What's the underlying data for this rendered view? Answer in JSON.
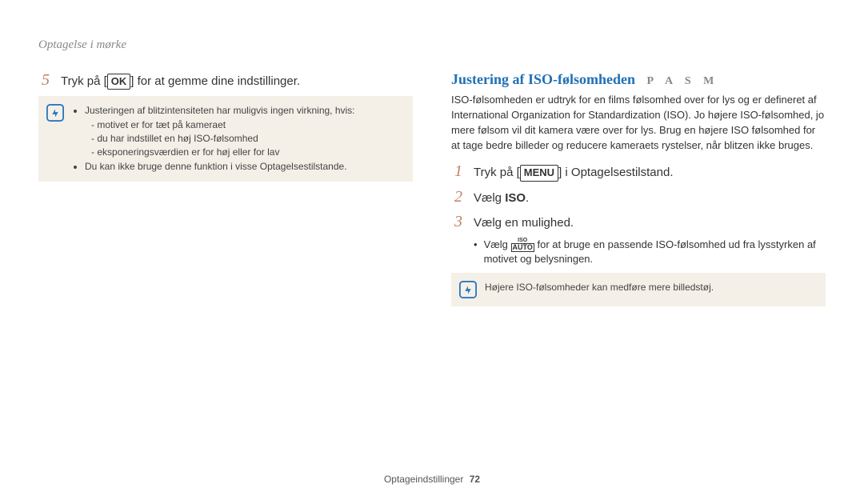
{
  "header": "Optagelse i mørke",
  "left": {
    "step5": {
      "num": "5",
      "pre": "Tryk på [",
      "key": "OK",
      "post": "] for at gemme dine indstillinger."
    },
    "note": {
      "intro": "Justeringen af blitzintensiteten har muligvis ingen virkning, hvis:",
      "sub": [
        "motivet er for tæt på kameraet",
        "du har indstillet en høj ISO-følsomhed",
        "eksponeringsværdien er for høj eller for lav"
      ],
      "line2": "Du kan ikke bruge denne funktion i visse Optagelsestilstande."
    }
  },
  "right": {
    "title": "Justering af ISO-følsomheden",
    "modes": "P A S M",
    "intro": "ISO-følsomheden er udtryk for en films følsomhed over for lys og er defineret af International Organization for Standardization (ISO). Jo højere ISO-følsomhed, jo mere følsom vil dit kamera være over for lys. Brug en højere ISO følsomhed for at tage bedre billeder og reducere kameraets rystelser, når blitzen ikke bruges.",
    "step1": {
      "num": "1",
      "pre": "Tryk på [",
      "key": "MENU",
      "post": "] i Optagelsestilstand."
    },
    "step2": {
      "num": "2",
      "pre": "Vælg ",
      "bold": "ISO",
      "post": "."
    },
    "step3": {
      "num": "3",
      "text": "Vælg en mulighed."
    },
    "step3_bullet": {
      "pre": "Vælg ",
      "post": " for at bruge en passende ISO-følsomhed ud fra lysstyrken af motivet og belysningen."
    },
    "note2": "Højere ISO-følsomheder kan medføre mere billedstøj."
  },
  "footer": {
    "label": "Optageindstillinger",
    "page": "72"
  }
}
